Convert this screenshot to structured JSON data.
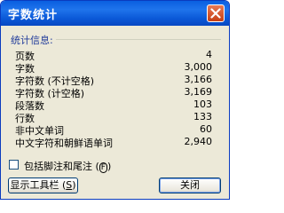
{
  "window": {
    "title": "字数统计",
    "close_label": "✕"
  },
  "section": {
    "label": "统计信息:"
  },
  "stats": [
    {
      "label": "页数",
      "value": "4"
    },
    {
      "label": "字数",
      "value": "3,000"
    },
    {
      "label": "字符数 (不计空格)",
      "value": "3,166"
    },
    {
      "label": "字符数 (计空格)",
      "value": "3,169"
    },
    {
      "label": "段落数",
      "value": "103"
    },
    {
      "label": "行数",
      "value": "133"
    },
    {
      "label": "非中文单词",
      "value": "60"
    },
    {
      "label": "中文字符和朝鲜语单词",
      "value": "2,940"
    }
  ],
  "options": {
    "include_footnotes_label": "包括脚注和尾注",
    "include_footnotes_key": "F",
    "include_footnotes_checked": false
  },
  "buttons": {
    "show_toolbar_label": "显示工具栏",
    "show_toolbar_key": "S",
    "close_label": "关闭"
  },
  "colors": {
    "title_bar": "#0a5fe0",
    "dialog_bg": "#ece9d8",
    "close_button": "#d9542a",
    "section_label": "#1f3a9a"
  }
}
